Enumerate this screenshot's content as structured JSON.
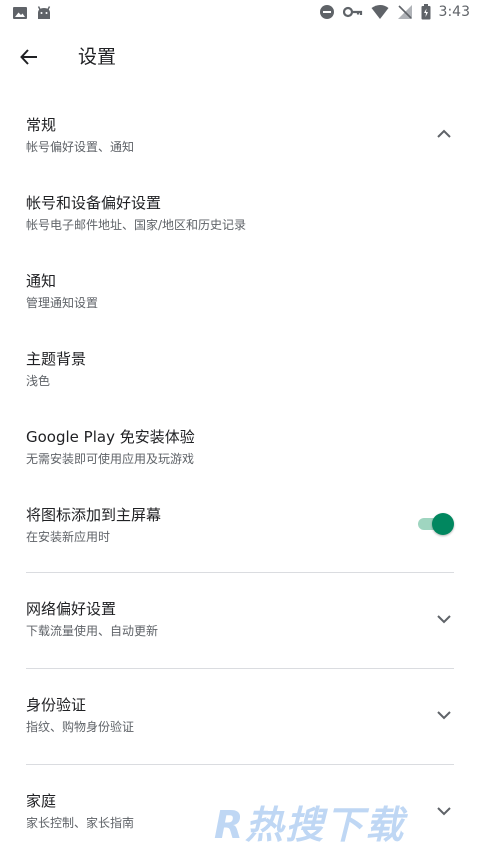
{
  "status_bar": {
    "time": "3:43",
    "icons": [
      "image-icon",
      "android-icon",
      "do-not-disturb-icon",
      "key-icon",
      "wifi-icon",
      "no-signal-icon",
      "battery-icon"
    ]
  },
  "header": {
    "title": "设置",
    "back_icon": "arrow-back-icon"
  },
  "sections": {
    "general": {
      "title": "常规",
      "subtitle": "帐号偏好设置、通知",
      "expanded": true,
      "items": {
        "account": {
          "title": "帐号和设备偏好设置",
          "subtitle": "帐号电子邮件地址、国家/地区和历史记录"
        },
        "notifications": {
          "title": "通知",
          "subtitle": "管理通知设置"
        },
        "theme": {
          "title": "主题背景",
          "subtitle": "浅色"
        },
        "instant": {
          "title": "Google Play 免安装体验",
          "subtitle": "无需安装即可使用应用及玩游戏"
        },
        "home_icon": {
          "title": "将图标添加到主屏幕",
          "subtitle": "在安装新应用时",
          "toggle_on": true
        }
      }
    },
    "network": {
      "title": "网络偏好设置",
      "subtitle": "下载流量使用、自动更新",
      "expanded": false
    },
    "auth": {
      "title": "身份验证",
      "subtitle": "指纹、购物身份验证",
      "expanded": false
    },
    "family": {
      "title": "家庭",
      "subtitle": "家长控制、家长指南",
      "expanded": false
    }
  },
  "watermark": "R热搜下载",
  "colors": {
    "accent": "#01875f",
    "toggle_track": "#9fd5c0",
    "text_primary": "#202124",
    "text_secondary": "#5f6368",
    "divider": "#dadce0",
    "watermark": "#4a8fe0"
  }
}
